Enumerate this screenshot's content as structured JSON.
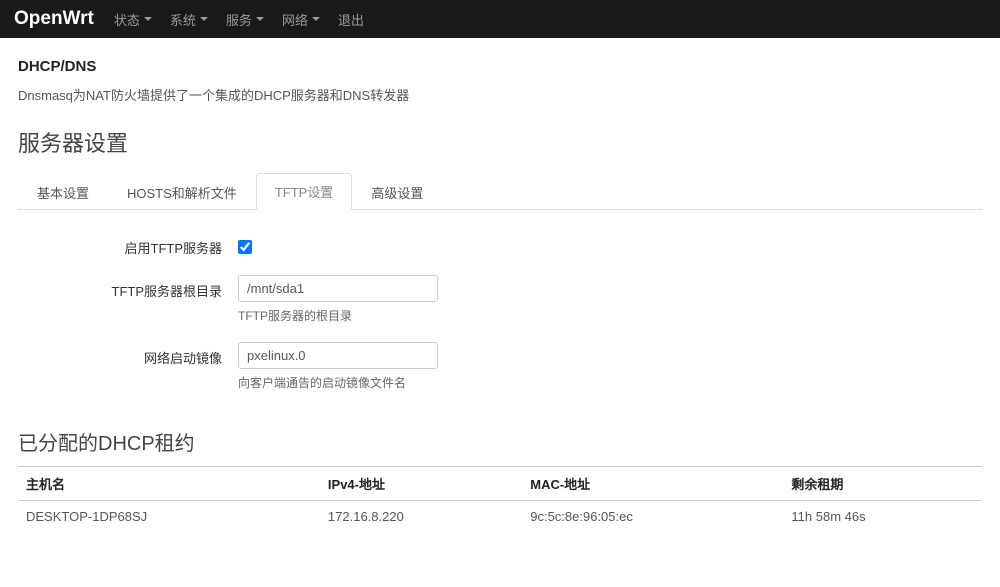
{
  "nav": {
    "brand": "OpenWrt",
    "items": [
      "状态",
      "系统",
      "服务",
      "网络"
    ],
    "logout": "退出"
  },
  "page": {
    "title": "DHCP/DNS",
    "desc": "Dnsmasq为NAT防火墙提供了一个集成的DHCP服务器和DNS转发器"
  },
  "settings": {
    "heading": "服务器设置",
    "tabs": [
      "基本设置",
      "HOSTS和解析文件",
      "TFTP设置",
      "高级设置"
    ],
    "active_tab": 2,
    "tftp": {
      "enable_label": "启用TFTP服务器",
      "enable_checked": true,
      "root_label": "TFTP服务器根目录",
      "root_value": "/mnt/sda1",
      "root_help": "TFTP服务器的根目录",
      "boot_label": "网络启动镜像",
      "boot_value": "pxelinux.0",
      "boot_help": "向客户端通告的启动镜像文件名"
    }
  },
  "leases": {
    "heading": "已分配的DHCP租约",
    "columns": [
      "主机名",
      "IPv4-地址",
      "MAC-地址",
      "剩余租期"
    ],
    "rows": [
      {
        "host": "DESKTOP-1DP68SJ",
        "ip": "172.16.8.220",
        "mac": "9c:5c:8e:96:05:ec",
        "remain": "11h 58m 46s"
      }
    ]
  }
}
